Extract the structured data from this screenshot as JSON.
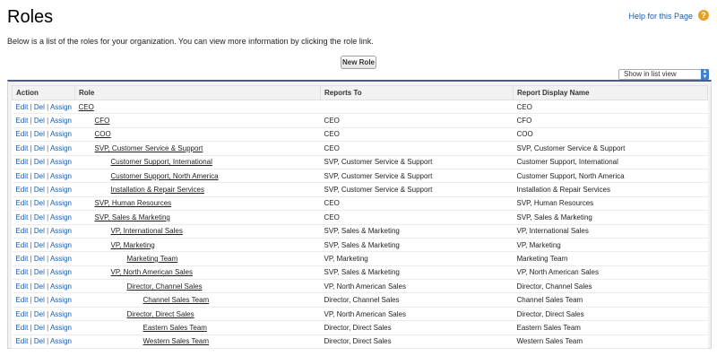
{
  "header": {
    "title": "Roles",
    "help_link": "Help for this Page",
    "help_icon_glyph": "?",
    "description": "Below is a list of the roles for your organization. You can view more information by clicking the role link."
  },
  "toolbar": {
    "new_role_label": "New Role",
    "view_select_value": "Show in list view"
  },
  "table": {
    "columns": [
      "Action",
      "Role",
      "Reports To",
      "Report Display Name"
    ],
    "actions": {
      "edit": "Edit",
      "del": "Del",
      "assign": "Assign",
      "sep": "|"
    },
    "rows": [
      {
        "role": "CEO",
        "level": 0,
        "reports_to": "",
        "display_name": "CEO"
      },
      {
        "role": "CFO",
        "level": 1,
        "reports_to": "CEO",
        "display_name": "CFO"
      },
      {
        "role": "COO",
        "level": 1,
        "reports_to": "CEO",
        "display_name": "COO"
      },
      {
        "role": "SVP, Customer Service & Support",
        "level": 1,
        "reports_to": "CEO",
        "display_name": "SVP, Customer Service & Support"
      },
      {
        "role": "Customer Support, International",
        "level": 2,
        "reports_to": "SVP, Customer Service & Support",
        "display_name": "Customer Support, International"
      },
      {
        "role": "Customer Support, North America",
        "level": 2,
        "reports_to": "SVP, Customer Service & Support",
        "display_name": "Customer Support, North America"
      },
      {
        "role": "Installation & Repair Services",
        "level": 2,
        "reports_to": "SVP, Customer Service & Support",
        "display_name": "Installation & Repair Services"
      },
      {
        "role": "SVP, Human Resources",
        "level": 1,
        "reports_to": "CEO",
        "display_name": "SVP, Human Resources"
      },
      {
        "role": "SVP, Sales & Marketing",
        "level": 1,
        "reports_to": "CEO",
        "display_name": "SVP, Sales & Marketing"
      },
      {
        "role": "VP, International Sales",
        "level": 2,
        "reports_to": "SVP, Sales & Marketing",
        "display_name": "VP, International Sales"
      },
      {
        "role": "VP, Marketing",
        "level": 2,
        "reports_to": "SVP, Sales & Marketing",
        "display_name": "VP, Marketing"
      },
      {
        "role": "Marketing Team",
        "level": 3,
        "reports_to": "VP, Marketing",
        "display_name": "Marketing Team"
      },
      {
        "role": "VP, North American Sales",
        "level": 2,
        "reports_to": "SVP, Sales & Marketing",
        "display_name": "VP, North American Sales"
      },
      {
        "role": "Director, Channel Sales",
        "level": 3,
        "reports_to": "VP, North American Sales",
        "display_name": "Director, Channel Sales"
      },
      {
        "role": "Channel Sales Team",
        "level": 4,
        "reports_to": "Director, Channel Sales",
        "display_name": "Channel Sales Team"
      },
      {
        "role": "Director, Direct Sales",
        "level": 3,
        "reports_to": "VP, North American Sales",
        "display_name": "Director, Direct Sales"
      },
      {
        "role": "Eastern Sales Team",
        "level": 4,
        "reports_to": "Director, Direct Sales",
        "display_name": "Eastern Sales Team"
      },
      {
        "role": "Western Sales Team",
        "level": 4,
        "reports_to": "Director, Direct Sales",
        "display_name": "Western Sales Team"
      }
    ]
  },
  "colors": {
    "link": "#1a5ca8",
    "help_icon": "#e8a021",
    "table_top_border": "#4a5a8a",
    "select_arrow": "#3b82d8"
  }
}
